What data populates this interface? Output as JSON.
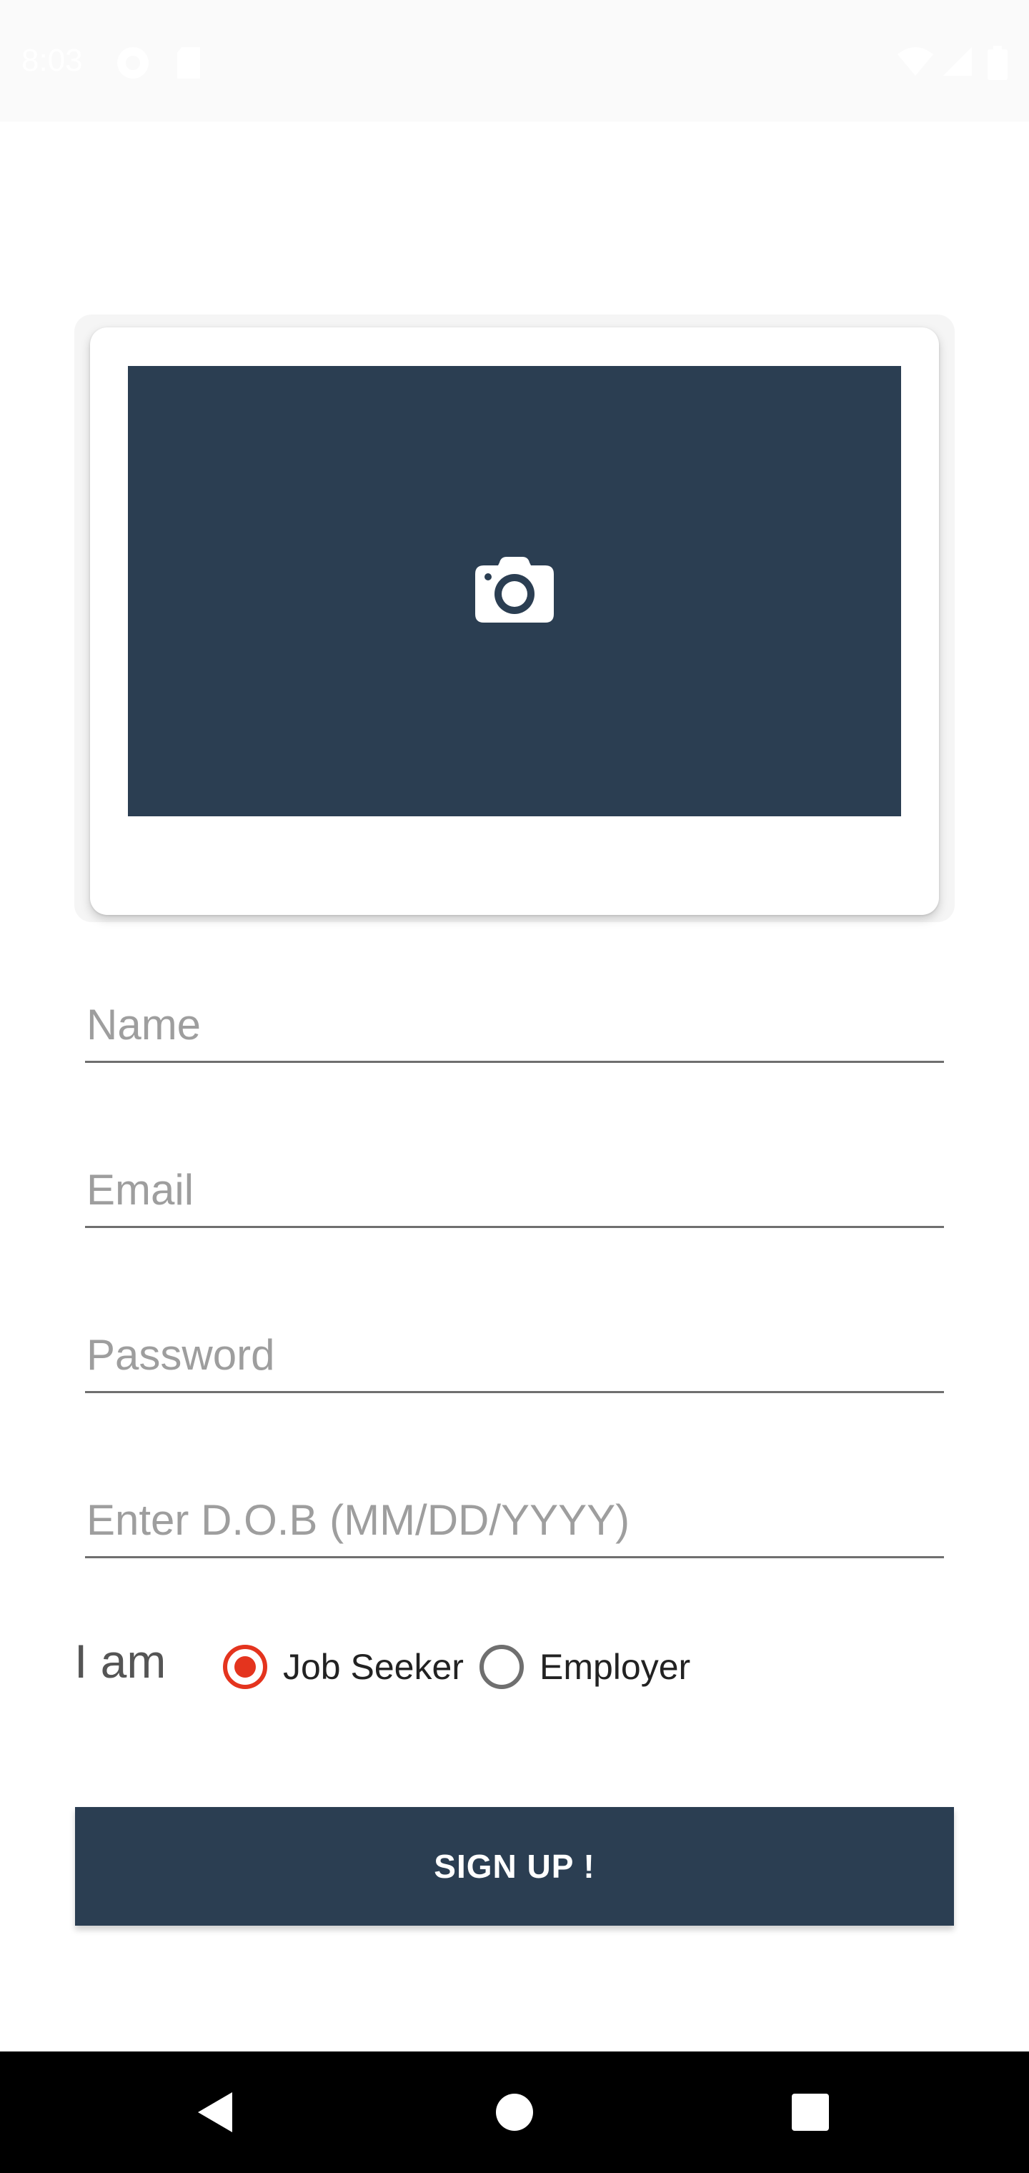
{
  "status_bar": {
    "time": "8:03",
    "icons": [
      "pocket-casts-icon",
      "sd-card-icon",
      "wifi-icon",
      "cell-signal-icon",
      "battery-icon"
    ]
  },
  "photo_picker": {
    "icon": "camera-icon",
    "background_color": "#2b3e52"
  },
  "form": {
    "name_placeholder": "Name",
    "email_placeholder": "Email",
    "password_placeholder": "Password",
    "dob_placeholder": "Enter D.O.B (MM/DD/YYYY)"
  },
  "role": {
    "label": "I am",
    "options": [
      {
        "label": "Job Seeker",
        "selected": true
      },
      {
        "label": "Employer",
        "selected": false
      }
    ],
    "accent_color": "#e4341e"
  },
  "signup_button": {
    "label": "SIGN UP !"
  },
  "nav_bar": {
    "buttons": [
      "back-icon",
      "home-icon",
      "recents-icon"
    ]
  }
}
